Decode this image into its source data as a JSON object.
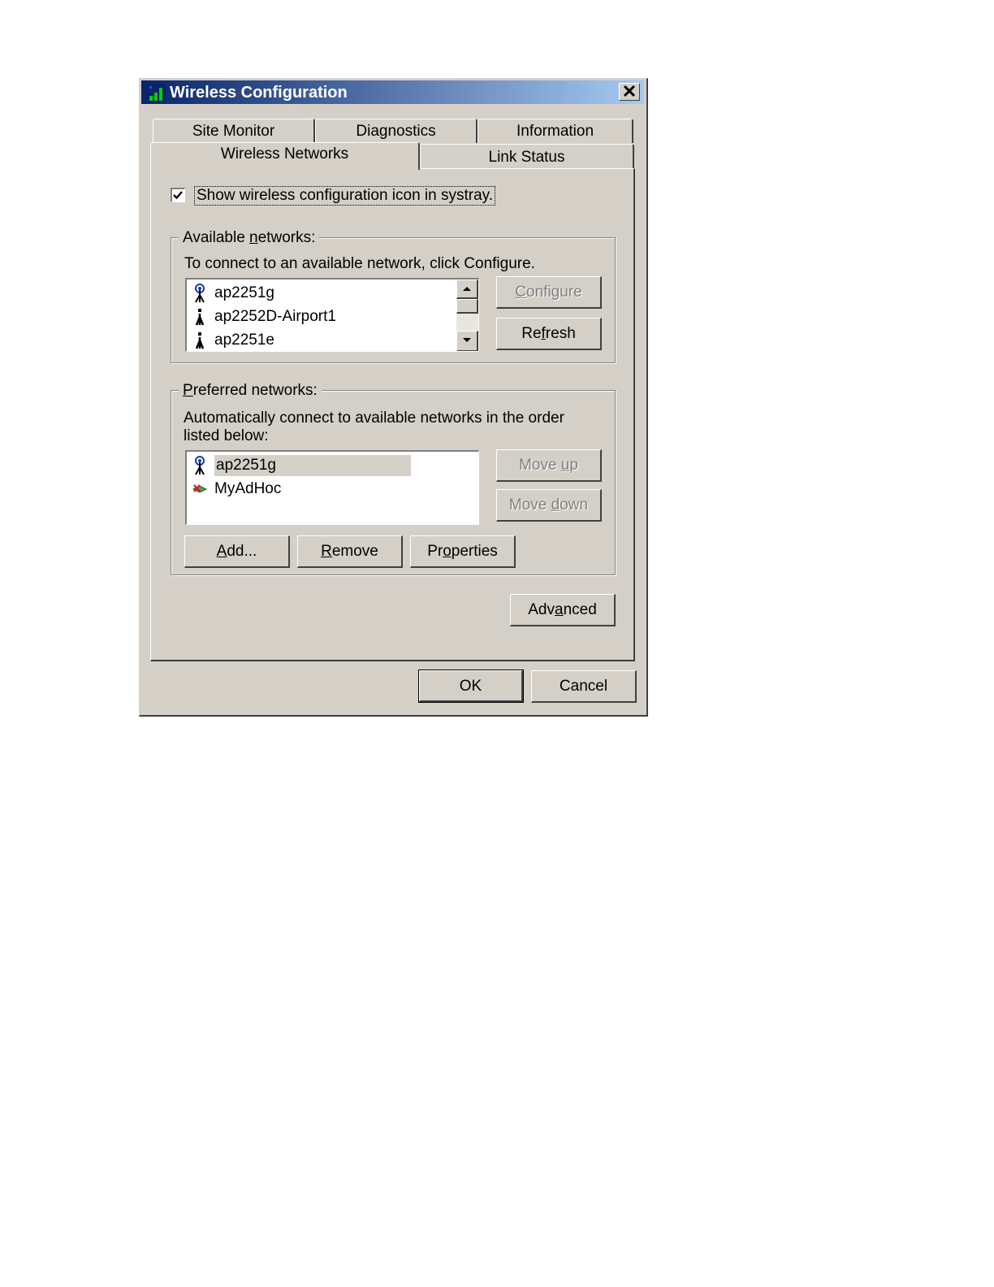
{
  "window": {
    "title": "Wireless Configuration",
    "close_label": "✕"
  },
  "tabs_top": [
    "Site Monitor",
    "Diagnostics",
    "Information"
  ],
  "tabs_bottom": [
    "Wireless Networks",
    "Link Status"
  ],
  "active_tab": "Wireless Networks",
  "systray_checkbox": {
    "label": "Show wireless configuration icon in systray.",
    "checked": true
  },
  "available": {
    "legend_pre": "Available ",
    "legend_u": "n",
    "legend_post": "etworks:",
    "instruction": "To connect to an available network, click Configure.",
    "items": [
      {
        "label": "ap2251g",
        "icon": "antenna-icon"
      },
      {
        "label": "ap2252D-Airport1",
        "icon": "access-point-icon"
      },
      {
        "label": "ap2251e",
        "icon": "access-point-icon"
      }
    ],
    "configure_pre": "",
    "configure_u": "C",
    "configure_post": "onfigure",
    "refresh_pre": "Re",
    "refresh_u": "f",
    "refresh_post": "resh"
  },
  "preferred": {
    "legend_pre": "",
    "legend_u": "P",
    "legend_post": "referred networks:",
    "instruction": "Automatically connect to available networks in the order listed below:",
    "items": [
      {
        "label": "ap2251g",
        "icon": "antenna-icon",
        "selected": true
      },
      {
        "label": "MyAdHoc",
        "icon": "adhoc-disconnected-icon",
        "selected": false
      }
    ],
    "move_up_pre": "Move ",
    "move_up_u": "u",
    "move_up_post": "p",
    "move_down_pre": "Move ",
    "move_down_u": "d",
    "move_down_post": "own",
    "add_pre": "",
    "add_u": "A",
    "add_post": "dd...",
    "remove_pre": "",
    "remove_u": "R",
    "remove_post": "emove",
    "properties_pre": "Pr",
    "properties_u": "o",
    "properties_post": "perties"
  },
  "advanced": {
    "pre": "Adv",
    "u": "a",
    "post": "nced"
  },
  "ok_label": "OK",
  "cancel_label": "Cancel",
  "colors": {
    "titlebar_start": "#0a246a",
    "titlebar_end": "#a6caf0",
    "face": "#d4d0c8",
    "selection": "#d4d0c8"
  }
}
